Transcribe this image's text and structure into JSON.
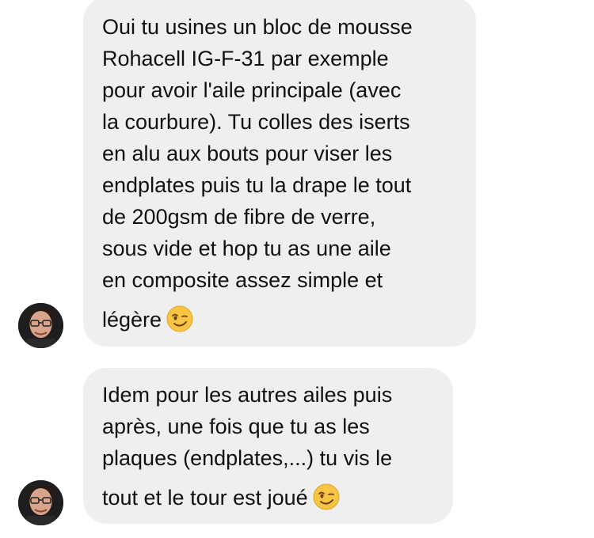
{
  "messages": [
    {
      "lines": [
        "Oui tu usines un bloc de mousse",
        "Rohacell IG-F-31 par exemple",
        "pour avoir l'aile principale (avec",
        "la courbure). Tu colles des iserts",
        "en alu aux bouts pour viser les",
        "endplates puis tu la drape le tout",
        "de 200gsm de fibre de verre,",
        "sous vide et hop tu as une aile",
        "en composite assez simple et"
      ],
      "last_line": "légère",
      "emoji": "winking-face"
    },
    {
      "lines": [
        "Idem pour les autres ailes puis",
        "après, une fois que tu as les",
        "plaques (endplates,...) tu vis le"
      ],
      "last_line": "tout et le tour est joué",
      "emoji": "winking-face"
    }
  ],
  "colors": {
    "bubble": "#efefef",
    "text": "#111111",
    "emoji_face": "#f7c444"
  }
}
